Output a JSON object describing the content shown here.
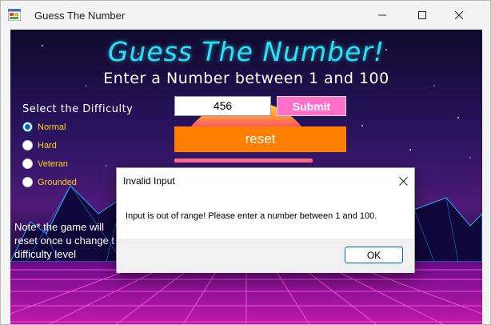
{
  "window": {
    "title": "Guess The Number"
  },
  "game": {
    "title": "Guess The Number!",
    "subtitle": "Enter a Number between 1 and 100",
    "difficulty_label": "Select the Difficulty",
    "difficulties": [
      {
        "label": "Normal",
        "selected": true
      },
      {
        "label": "Hard",
        "selected": false
      },
      {
        "label": "Veteran",
        "selected": false
      },
      {
        "label": "Grounded",
        "selected": false
      }
    ],
    "input_value": "456",
    "submit_label": "Submit",
    "reset_label": "reset",
    "note_lines": [
      "Note* the game will",
      "reset once u change t",
      "difficulty level"
    ]
  },
  "dialog": {
    "title": "Invalid Input",
    "message": "Input is out of range! Please enter a number between 1 and 100.",
    "ok_label": "OK"
  },
  "colors": {
    "title_cyan": "#2fe0f2",
    "radio_label_yellow": "#ffd21a",
    "submit_pink": "#ff70c8",
    "reset_orange": "#ff8000",
    "accent_blue": "#0067c0"
  }
}
